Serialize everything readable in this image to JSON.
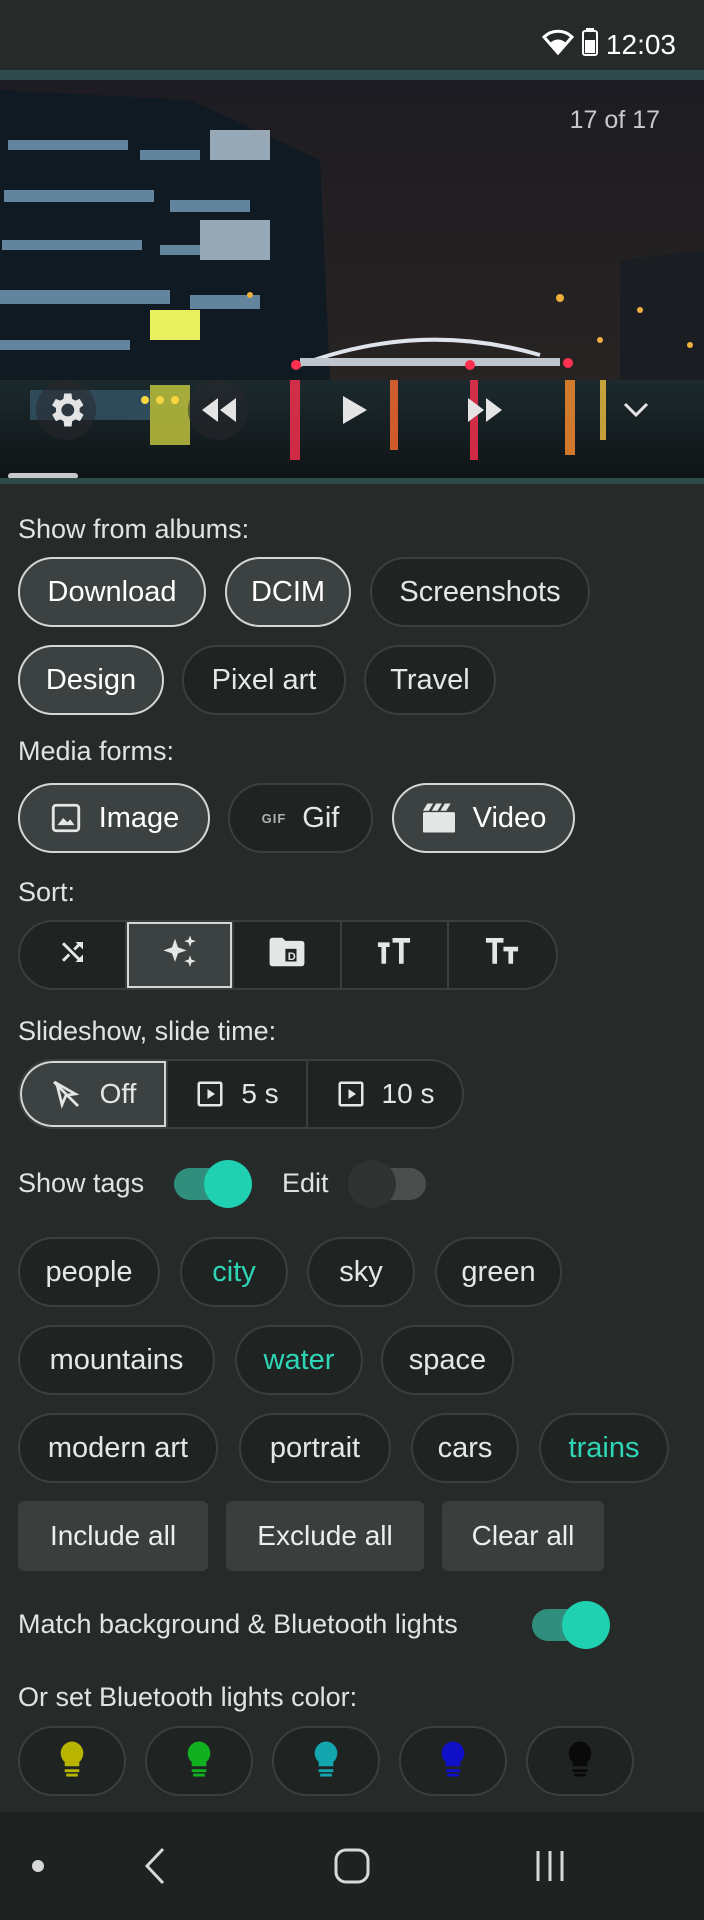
{
  "status_bar": {
    "time": "12:03",
    "wifi_icon": "wifi-icon",
    "battery_icon": "battery-icon"
  },
  "viewer": {
    "counter": "17 of 17",
    "controls": [
      "gear-icon",
      "rewind-icon",
      "play-icon",
      "fast-forward-icon",
      "chevron-down-icon"
    ]
  },
  "albums": {
    "label": "Show from albums:",
    "items": [
      {
        "label": "Download",
        "selected": true
      },
      {
        "label": "DCIM",
        "selected": true
      },
      {
        "label": "Screenshots",
        "selected": false
      },
      {
        "label": "Design",
        "selected": true
      },
      {
        "label": "Pixel art",
        "selected": false
      },
      {
        "label": "Travel",
        "selected": false
      }
    ]
  },
  "media_forms": {
    "label": "Media forms:",
    "items": [
      {
        "label": "Image",
        "icon": "image-icon",
        "selected": true
      },
      {
        "label": "Gif",
        "icon": "gif-icon",
        "icon_text": "GIF",
        "selected": false
      },
      {
        "label": "Video",
        "icon": "video-clapper-icon",
        "selected": true
      }
    ]
  },
  "sort": {
    "label": "Sort:",
    "options": [
      "shuffle-icon",
      "sparkle-icon",
      "folder-icon",
      "text-size-large-icon",
      "text-size-small-icon"
    ],
    "selected_index": 1
  },
  "slideshow": {
    "label": "Slideshow, slide time:",
    "options": [
      {
        "label": "Off",
        "icon": "pointer-off-icon",
        "selected": true
      },
      {
        "label": "5 s",
        "icon": "slideshow-play-icon",
        "selected": false
      },
      {
        "label": "10 s",
        "icon": "slideshow-play-icon",
        "selected": false
      }
    ]
  },
  "tags_row": {
    "show_tags_label": "Show tags",
    "show_tags_on": true,
    "edit_label": "Edit",
    "edit_on": false
  },
  "tags": [
    {
      "label": "people",
      "active": false
    },
    {
      "label": "city",
      "active": true
    },
    {
      "label": "sky",
      "active": false
    },
    {
      "label": "green",
      "active": false
    },
    {
      "label": "mountains",
      "active": false
    },
    {
      "label": "water",
      "active": true
    },
    {
      "label": "space",
      "active": false
    },
    {
      "label": "modern art",
      "active": false
    },
    {
      "label": "portrait",
      "active": false
    },
    {
      "label": "cars",
      "active": false
    },
    {
      "label": "trains",
      "active": true
    }
  ],
  "tag_actions": {
    "include_all": "Include all",
    "exclude_all": "Exclude all",
    "clear_all": "Clear all"
  },
  "lights": {
    "match_label": "Match background & Bluetooth lights",
    "match_on": true,
    "color_label": "Or set Bluetooth lights color:",
    "bulbs": [
      {
        "icon": "lightbulb-icon",
        "color": "#b8b400"
      },
      {
        "icon": "lightbulb-icon",
        "color": "#10b020"
      },
      {
        "icon": "lightbulb-icon",
        "color": "#14a6ae"
      },
      {
        "icon": "lightbulb-icon",
        "color": "#1010c8"
      },
      {
        "icon": "lightbulb-icon",
        "color": "#0a0a0a"
      }
    ]
  },
  "nav_bar": [
    "dot-icon",
    "back-icon",
    "home-icon",
    "recents-icon"
  ],
  "colors": {
    "accent": "#1fd1b0",
    "background": "#262b2a",
    "chip_bg": "#1f2423",
    "teal_text": "#2fd6b6"
  }
}
